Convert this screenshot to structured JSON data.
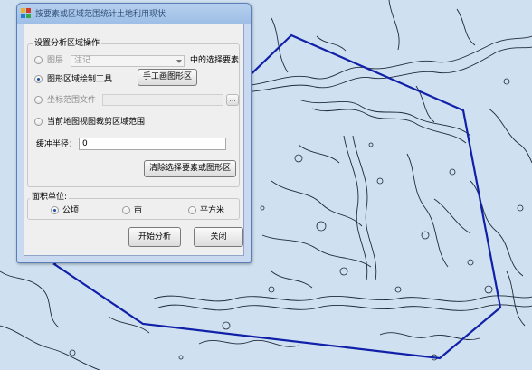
{
  "dialog": {
    "title": "按要素或区域范围统计土地利用现状",
    "icon": "app-window-icon",
    "group_operation": {
      "legend": "设置分析区域操作",
      "option_layer": {
        "label": "图层",
        "selected": false,
        "combo_value": "注记",
        "suffix": "中的选择要素"
      },
      "option_draw": {
        "label": "图形区域绘制工具",
        "selected": true,
        "button": "手工画图形区"
      },
      "option_coord_file": {
        "label": "坐标范围文件",
        "selected": false,
        "file_value": "",
        "browse_button": "..."
      },
      "option_current_map": {
        "label": "当前地图视图裁剪区域范围",
        "selected": false
      },
      "buffer_label": "缓冲半径：",
      "buffer_value": "0",
      "clear_button": "清除选择要素或图形区"
    },
    "group_units": {
      "legend": "面积单位:",
      "options": [
        {
          "label": "公顷",
          "selected": true
        },
        {
          "label": "亩",
          "selected": false
        },
        {
          "label": "平方米",
          "selected": false
        }
      ]
    },
    "start_button": "开始分析",
    "close_button": "关闭"
  },
  "map": {
    "background_color": "#cfe0f0",
    "line_color": "#1f2b3a",
    "selection_polygon_color": "#1020a8"
  }
}
